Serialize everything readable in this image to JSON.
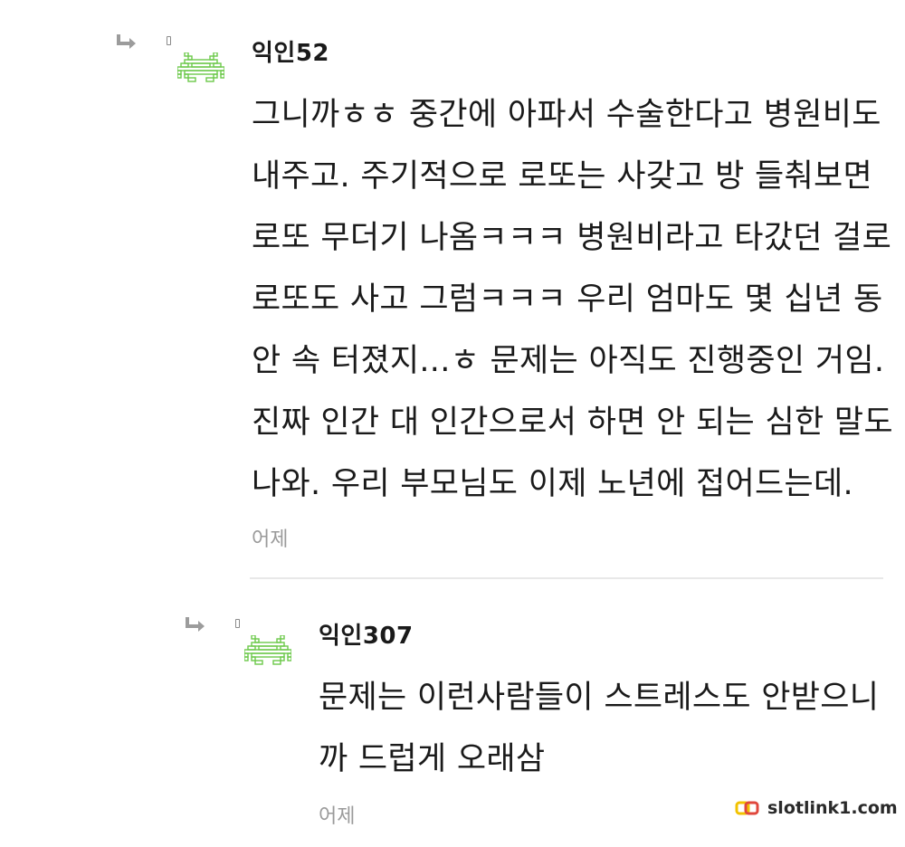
{
  "comments": [
    {
      "author": "익인52",
      "lines": [
        "그니까ㅎㅎ 중간에 아파서 수술한다고 병원비도",
        "내주고. 주기적으로 로또는 사갖고 방 들춰보면",
        "로또 무더기 나옴ㅋㅋㅋ 병원비라고 타갔던 걸로",
        "로또도 사고 그럼ㅋㅋㅋ 우리 엄마도 몇 십년 동",
        "안 속 터졌지...ㅎ 문제는 아직도 진행중인 거임.",
        "진짜 인간 대 인간으로서 하면 안 되는 심한 말도",
        "나와. 우리 부모님도 이제 노년에 접어드는데."
      ],
      "time": "어제"
    },
    {
      "author": "익인307",
      "lines": [
        "문제는 이런사람들이 스트레스도 안받으니",
        "까 드럽게 오래삼"
      ],
      "time": "어제"
    }
  ],
  "watermark": {
    "text": "slotlink1.com",
    "colors": [
      "#f2c200",
      "#e0473c"
    ]
  },
  "icons": {
    "reply": "reply-arrow-icon",
    "avatar": "space-invader-avatar-icon"
  },
  "accent_color": "#6cc94a"
}
